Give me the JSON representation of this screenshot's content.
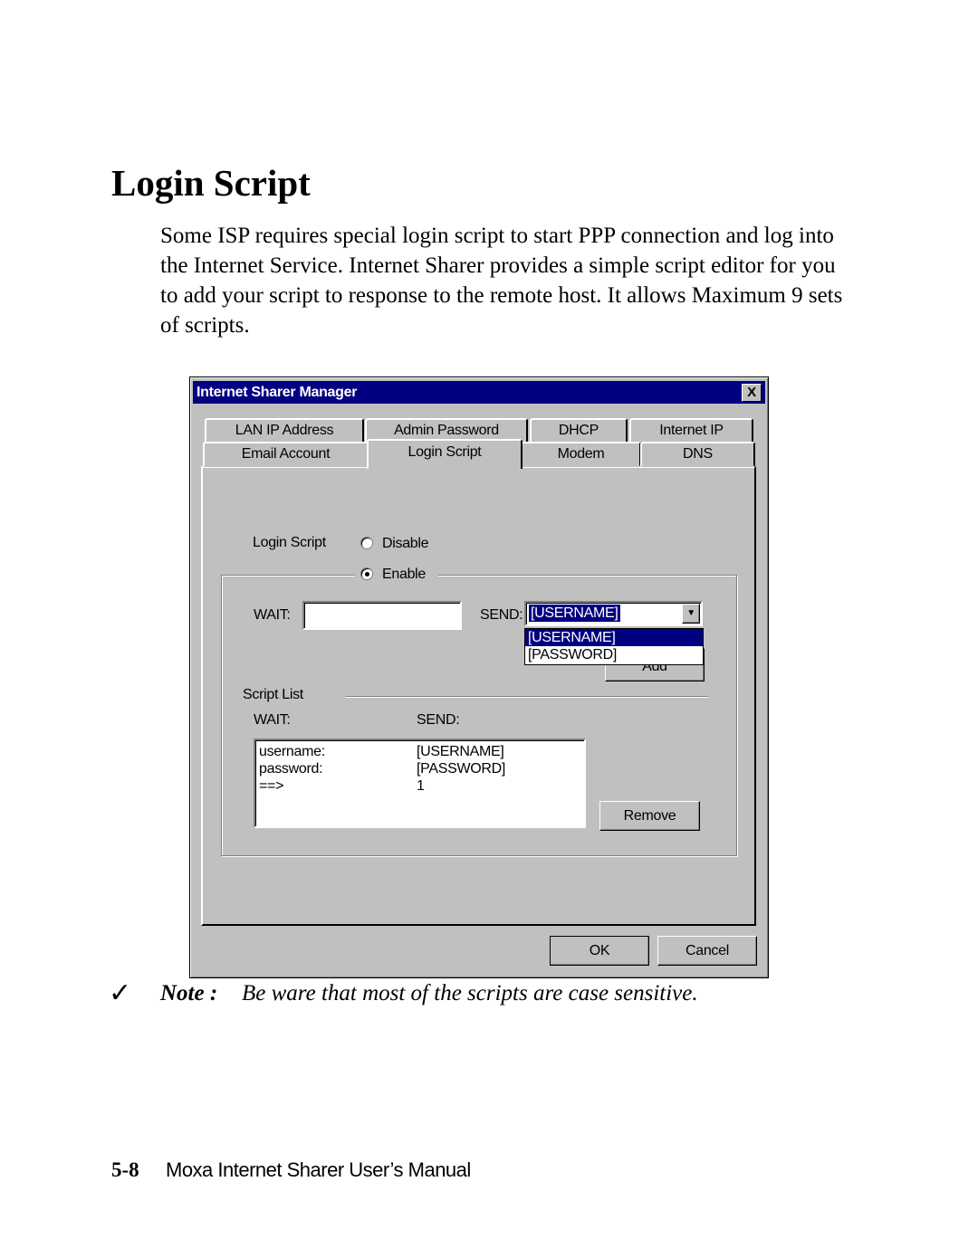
{
  "heading": "Login Script",
  "paragraph": "Some ISP requires special login script to start PPP connection and log into the Internet Service. Internet Sharer provides a simple script editor for you to add your script to response to the remote host. It allows Maximum 9 sets of scripts.",
  "dialog": {
    "title": "Internet Sharer Manager",
    "close_glyph": "X",
    "tabs_row1": [
      "LAN IP Address",
      "Admin Password",
      "DHCP",
      "Internet IP"
    ],
    "tabs_row2": [
      "Email Account",
      "Login Script",
      "Modem",
      "DNS"
    ],
    "active_tab": "Login Script",
    "login_script_label": "Login Script",
    "radio_disable": "Disable",
    "radio_enable": "Enable",
    "selected_radio": "Enable",
    "wait_label": "WAIT:",
    "wait_value": "",
    "send_label": "SEND:",
    "send_value": "[USERNAME]",
    "send_options": [
      "[USERNAME]",
      "[PASSWORD]"
    ],
    "add_label": "Add",
    "script_list_label": "Script List",
    "list_wait_header": "WAIT:",
    "list_send_header": "SEND:",
    "script_rows": [
      {
        "wait": "username:",
        "send": "[USERNAME]"
      },
      {
        "wait": "password:",
        "send": "[PASSWORD]"
      },
      {
        "wait": "==>",
        "send": "1"
      }
    ],
    "remove_label": "Remove",
    "ok_label": "OK",
    "cancel_label": "Cancel"
  },
  "note": {
    "checkmark": "✓",
    "label": "Note :",
    "text": "Be ware that most of the scripts are case sensitive."
  },
  "footer": {
    "page_number": "5-8",
    "manual_title": "Moxa Internet Sharer User’s Manual"
  },
  "colors": {
    "titlebar": "#000080",
    "dialog_bg": "#c0c0c0",
    "selection": "#000080"
  }
}
